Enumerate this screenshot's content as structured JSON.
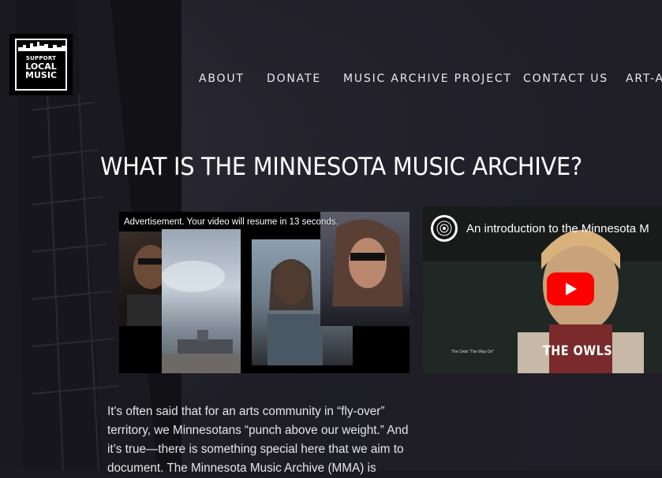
{
  "logo": {
    "line1": "SUPPORT",
    "line2": "LOCAL",
    "line3": "MUSIC"
  },
  "nav": {
    "items": [
      {
        "label": "ABOUT"
      },
      {
        "label": "DONATE"
      },
      {
        "label": "MUSIC ARCHIVE PROJECT"
      },
      {
        "label": "CONTACT US"
      },
      {
        "label": "ART-A-"
      }
    ]
  },
  "page": {
    "title": "WHAT IS THE MINNESOTA MUSIC ARCHIVE?"
  },
  "video_ad": {
    "overlay_text": "Advertisement. Your video will resume in 13 seconds."
  },
  "video_intro": {
    "title": "An introduction to the Minnesota M",
    "caption_small": "The Owls \"The Way On\"",
    "caption_large": "THE OWLS"
  },
  "body": {
    "paragraph": "It's often said that for an arts community in “fly-over” territory, we Minnesotans “punch above our weight.” And it’s true—there is something special here that we aim to document. The Minnesota Music Archive (MMA) is"
  },
  "colors": {
    "background": "#1b1a22",
    "play_button": "#ff0000",
    "text": "#ffffff"
  }
}
